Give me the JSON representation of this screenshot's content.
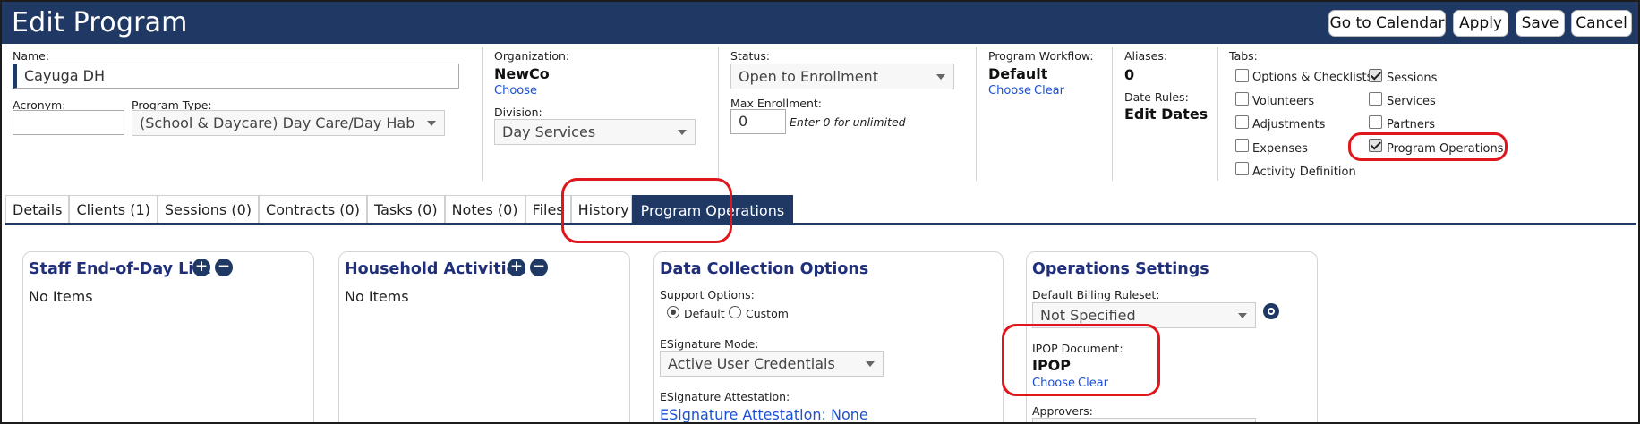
{
  "header": {
    "title": "Edit Program",
    "buttons": {
      "calendar": "Go to Calendar",
      "apply": "Apply",
      "save": "Save",
      "cancel": "Cancel"
    }
  },
  "form": {
    "name_label": "Name:",
    "name_value": "Cayuga DH",
    "acronym_label": "Acronym:",
    "acronym_value": "",
    "program_type_label": "Program Type:",
    "program_type_value": "(School & Daycare) Day Care/Day Hab",
    "organization_label": "Organization:",
    "organization_value": "NewCo",
    "organization_choose": "Choose",
    "division_label": "Division:",
    "division_value": "Day Services",
    "status_label": "Status:",
    "status_value": "Open to Enrollment",
    "max_enrollment_label": "Max Enrollment:",
    "max_enrollment_value": "0",
    "max_enrollment_hint": "Enter 0 for unlimited",
    "workflow_label": "Program Workflow:",
    "workflow_value": "Default",
    "workflow_choose": "Choose",
    "workflow_clear": "Clear",
    "aliases_label": "Aliases:",
    "aliases_value": "0",
    "date_rules_label": "Date Rules:",
    "date_rules_value": "Edit Dates"
  },
  "tab_options": {
    "label": "Tabs:",
    "items": [
      {
        "label": "Options & Checklists",
        "checked": false
      },
      {
        "label": "Volunteers",
        "checked": false
      },
      {
        "label": "Adjustments",
        "checked": false
      },
      {
        "label": "Expenses",
        "checked": false
      },
      {
        "label": "Activity Definition",
        "checked": false
      },
      {
        "label": "Sessions",
        "checked": true
      },
      {
        "label": "Services",
        "checked": false
      },
      {
        "label": "Partners",
        "checked": false
      },
      {
        "label": "Program Operations",
        "checked": true
      }
    ]
  },
  "tabs": [
    {
      "label": "Details"
    },
    {
      "label": "Clients (1)"
    },
    {
      "label": "Sessions (0)"
    },
    {
      "label": "Contracts (0)"
    },
    {
      "label": "Tasks (0)"
    },
    {
      "label": "Notes (0)"
    },
    {
      "label": "Files"
    },
    {
      "label": "History"
    },
    {
      "label": "Program Operations"
    }
  ],
  "panels": {
    "staff": {
      "title": "Staff End-of-Day List",
      "empty": "No Items",
      "add": "+",
      "remove": "−"
    },
    "household": {
      "title": "Household Activities",
      "empty": "No Items",
      "add": "+",
      "remove": "−"
    },
    "data_collection": {
      "title": "Data Collection Options",
      "support_label": "Support Options:",
      "support_default": "Default",
      "support_custom": "Custom",
      "support_selected": "Default",
      "esig_mode_label": "ESignature Mode:",
      "esig_mode_value": "Active User Credentials",
      "esig_attest_label": "ESignature Attestation:",
      "esig_attest_value": "ESignature Attestation: None"
    },
    "operations": {
      "title": "Operations Settings",
      "billing_label": "Default Billing Ruleset:",
      "billing_value": "Not Specified",
      "ipop_label": "IPOP Document:",
      "ipop_value": "IPOP",
      "ipop_choose": "Choose",
      "ipop_clear": "Clear",
      "approvers_label": "Approvers:"
    }
  },
  "colors": {
    "header_bg": "#1f3864",
    "accent_title": "#1f2f7a",
    "link": "#1a4fd6",
    "annotation": "#e0161d"
  }
}
